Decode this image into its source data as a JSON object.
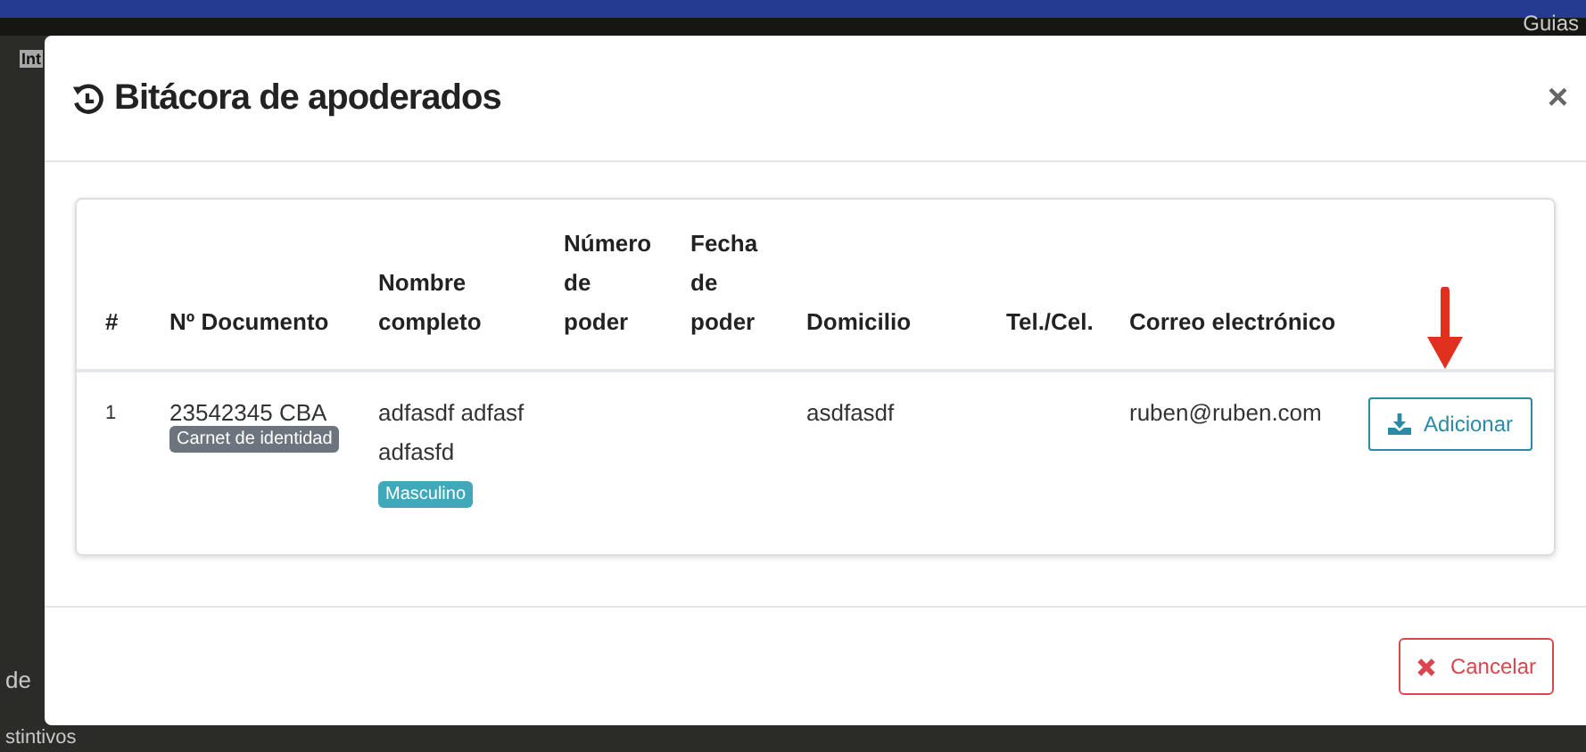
{
  "background_app": {
    "top_left_text": "Int",
    "top_right_text": "Guias",
    "bottom_left_texts": [
      "de",
      "stintivos"
    ]
  },
  "modal": {
    "title": "Bitácora de apoderados",
    "close": "×",
    "table": {
      "columns": [
        "#",
        "Nº Documento",
        "Nombre completo",
        "Número de poder",
        "Fecha de poder",
        "Domicilio",
        "Tel./Cel.",
        "Correo electrónico"
      ],
      "rows": [
        {
          "number": "1",
          "document": "23542345 CBA",
          "document_badge": {
            "text": "Carnet de identidad",
            "color": "#6c757d"
          },
          "name": "adfasdf adfasf adfasfd",
          "name_badge": {
            "text": "Masculino",
            "color": "#3fa9b9"
          },
          "address": "asdfasdf",
          "email": "ruben@ruben.com",
          "action": "Adicionar"
        }
      ]
    },
    "cancel": "Cancelar"
  }
}
